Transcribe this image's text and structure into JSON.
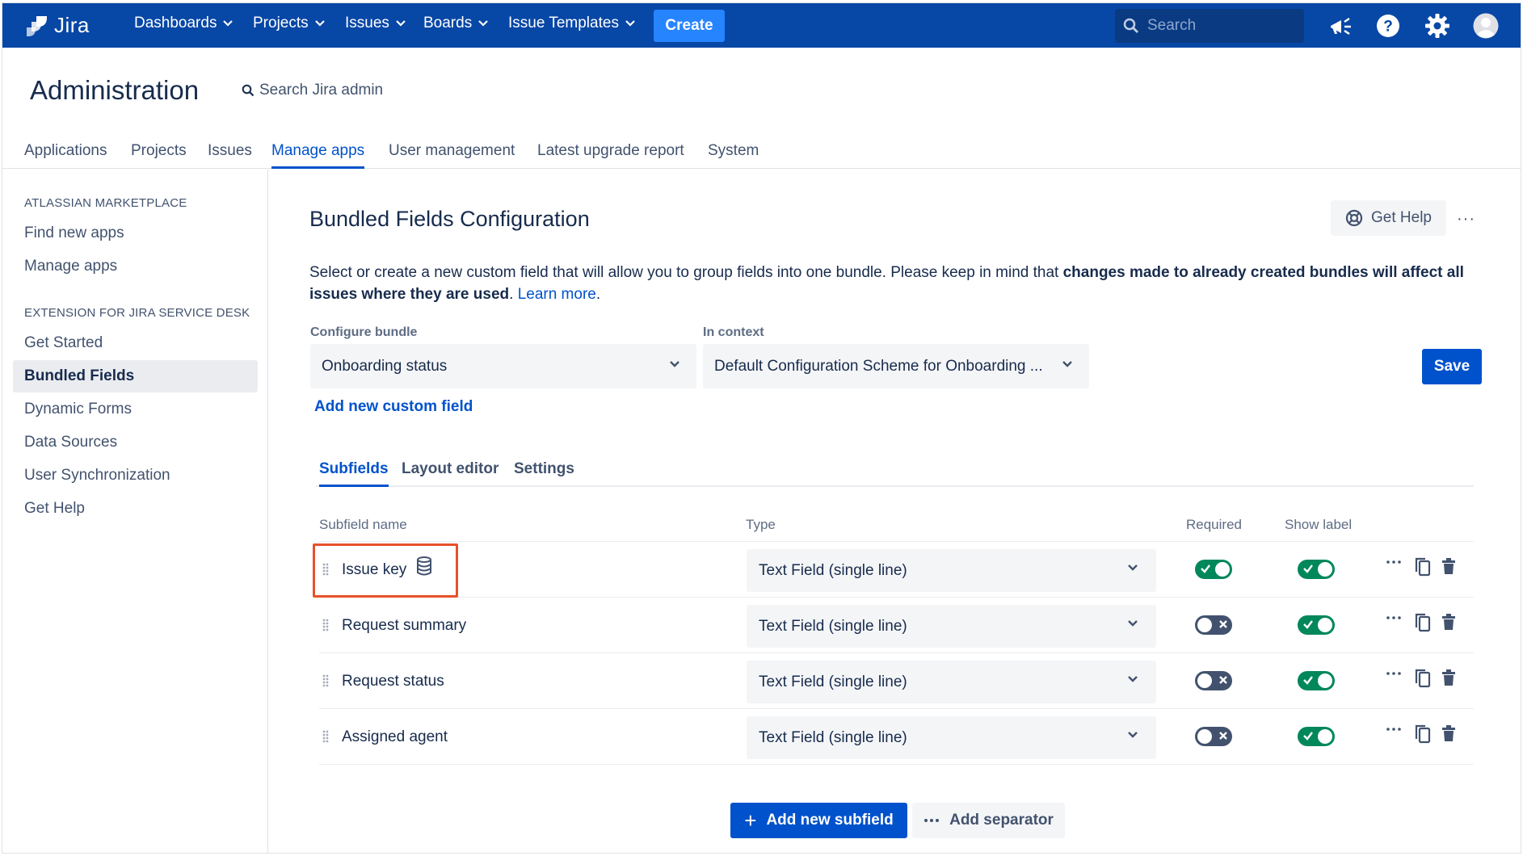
{
  "app": {
    "name": "Jira"
  },
  "topnav": {
    "items": [
      {
        "label": "Dashboards"
      },
      {
        "label": "Projects"
      },
      {
        "label": "Issues"
      },
      {
        "label": "Boards"
      },
      {
        "label": "Issue Templates"
      }
    ],
    "create_label": "Create",
    "search_placeholder": "Search",
    "icons": [
      "megaphone-icon",
      "help-icon",
      "settings-icon",
      "avatar-icon"
    ]
  },
  "admin": {
    "title": "Administration",
    "search_label": "Search Jira admin",
    "tabs": [
      {
        "label": "Applications"
      },
      {
        "label": "Projects"
      },
      {
        "label": "Issues"
      },
      {
        "label": "Manage apps",
        "active": true
      },
      {
        "label": "User management"
      },
      {
        "label": "Latest upgrade report"
      },
      {
        "label": "System"
      }
    ]
  },
  "sidebar": {
    "section1": "ATLASSIAN MARKETPLACE",
    "section1_items": [
      {
        "label": "Find new apps"
      },
      {
        "label": "Manage apps"
      }
    ],
    "section2": "EXTENSION FOR JIRA SERVICE DESK",
    "section2_items": [
      {
        "label": "Get Started"
      },
      {
        "label": "Bundled Fields",
        "active": true
      },
      {
        "label": "Dynamic Forms"
      },
      {
        "label": "Data Sources"
      },
      {
        "label": "User Synchronization"
      },
      {
        "label": "Get Help"
      }
    ]
  },
  "main": {
    "title": "Bundled Fields Configuration",
    "get_help_label": "Get Help",
    "more_label": "···",
    "desc_part1": "Select or create a new custom field that will allow you to group fields into one bundle. Please keep in mind that ",
    "desc_bold": "changes made to already created bundles will affect all issues where they are used",
    "desc_part2": ". ",
    "learn_more": "Learn more",
    "desc_end": ".",
    "configure_label": "Configure bundle",
    "configure_value": "Onboarding status",
    "context_label": "In context",
    "context_value": "Default Configuration Scheme for Onboarding ...",
    "save_label": "Save",
    "add_custom_field": "Add new custom field",
    "tabs": [
      {
        "label": "Subfields",
        "active": true
      },
      {
        "label": "Layout editor"
      },
      {
        "label": "Settings"
      }
    ],
    "columns": {
      "name": "Subfield name",
      "type": "Type",
      "required": "Required",
      "show_label": "Show label"
    },
    "rows": [
      {
        "name": "Issue key",
        "type": "Text Field (single line)",
        "required": true,
        "show_label": true,
        "has_data_source": true
      },
      {
        "name": "Request summary",
        "type": "Text Field (single line)",
        "required": false,
        "show_label": true
      },
      {
        "name": "Request status",
        "type": "Text Field (single line)",
        "required": false,
        "show_label": true
      },
      {
        "name": "Assigned agent",
        "type": "Text Field (single line)",
        "required": false,
        "show_label": true
      }
    ],
    "add_subfield_label": "Add new subfield",
    "add_separator_label": "Add separator"
  },
  "colors": {
    "nav_bg": "#0747a6",
    "primary": "#0052cc",
    "toggle_on": "#00875a",
    "toggle_off": "#42526e",
    "highlight": "#e8502a"
  }
}
